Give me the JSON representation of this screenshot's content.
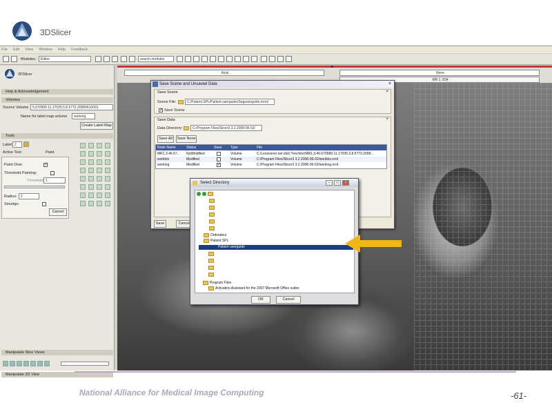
{
  "slide": {
    "logo_text": "3DSlicer",
    "footer": "National Alliance for Medical Image Computing",
    "page_number": "-61-"
  },
  "app": {
    "menu": [
      "File",
      "Edit",
      "View",
      "Window",
      "Help",
      "Feedback"
    ],
    "toolbar": {
      "modules_label": "Modules:",
      "module_value": "Editor",
      "search_placeholder": "search modules"
    },
    "left_panel": {
      "brand": "3DSlicer",
      "sections": {
        "help": "Help & Acknowledgement",
        "volumes": "Volumes",
        "tools": "Tools",
        "manipulate_slice": "Manipulate Slice Views",
        "manipulate_3d": "Manipulate 3D View"
      },
      "source_volume_label": "Source Volume",
      "source_volume_value": "5.670589 11.17035.5.8.5772.20080610091",
      "label_map_name_label": "Name for label map volume",
      "label_map_name_value": "working",
      "create_label_map_button": "Create Label Map",
      "label_label": "Label",
      "label_value": "2",
      "active_tool_label": "Active Tool:",
      "active_tool_value": "Paint",
      "paint_over_label": "Paint Over:",
      "threshold_painting_label": "Threshold Painting:",
      "threshold_label": "Threshold:",
      "threshold_value": "1",
      "radius_label": "Radius:",
      "radius_value": "2",
      "smudge_label": "Smudge:",
      "cancel_button": "Cancel"
    },
    "slice_views": {
      "left_view": "Axial",
      "right_view": "None",
      "right_value": "MR 1, 834"
    }
  },
  "save_dialog": {
    "title": "Save Scene and Unsaved Data",
    "save_scene_group": "Save Scene",
    "scene_file_label": "Scene File:",
    "scene_file_value": "C:/Patient SPL/Patient userguide/Seguserguide.mrml",
    "save_scene_checkbox": "Save Scene",
    "save_data_group": "Save Data",
    "data_directory_label": "Data Directory:",
    "data_directory_value": "C:/Program Files/Slicer3 3.2.2008-06-02/",
    "save_all_button": "Save All",
    "save_none_button": "Save None",
    "columns": [
      "Node Name",
      "Status",
      "Save",
      "Type",
      "File"
    ],
    "rows": [
      {
        "node": "MR1.3.46.67..",
        "status": "NotModified",
        "save": false,
        "type": "Volume",
        "file": "C:/Lesscener.net.dicit.?ere/lore/MR1.3.46.670589.11.17035.5.8.5772.2008..."
      },
      {
        "node": "workbis",
        "status": "Modified",
        "save": false,
        "type": "Volume",
        "file": "C:/Program Files/Slicer3 3.2.2008-06-02/workbis.nrrd"
      },
      {
        "node": "working",
        "status": "Modified",
        "save": true,
        "type": "Volume",
        "file": "C:/Program Files/Slicer3 3.2.2008-06-02/working.nrrd"
      }
    ],
    "save_button": "Save",
    "cancel_button": "Cancel"
  },
  "dir_dialog": {
    "title": "Select Directory",
    "tree": {
      "ordinateur": "Ordinateur",
      "patient_spl": "Patient SPL",
      "patient_userguide": "Patient userguide",
      "program_files": "Program Files",
      "activation_assistant": "Activation Assistant for the 2007 Microsoft Office suites"
    },
    "ok_button": "OK",
    "cancel_button": "Cancel"
  },
  "colors": {
    "arrow": "#f2b417",
    "selection": "#1c3e7c",
    "footer_rule": "#b6a4d8"
  }
}
